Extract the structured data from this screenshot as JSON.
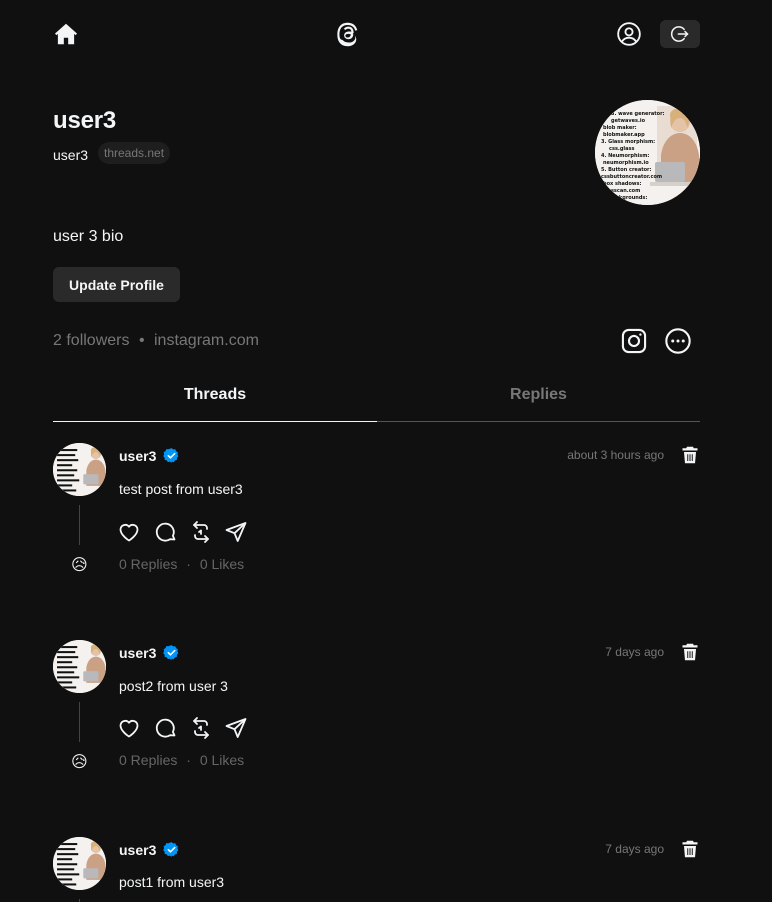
{
  "header": {
    "home_icon": "home-icon",
    "logo_icon": "threads-logo-icon",
    "profile_icon": "user-circle-icon",
    "logout_icon": "logout-icon"
  },
  "profile": {
    "name": "user3",
    "handle": "user3",
    "domain": "threads.net",
    "bio": "user 3 bio",
    "update_button": "Update Profile",
    "followers": "2 followers",
    "separator": "•",
    "link": "instagram.com",
    "avatar_caption_lines": [
      "wave generator:",
      "...",
      "blob maker:",
      "blobmaker.app",
      "3. Glass morphism:",
      "css.glass",
      "4. Neumorphism:",
      "neumorphism.io",
      "5. Button creator:",
      "cssbuttoncreator.com",
      "box shadows:",
      "...",
      "backgrounds:"
    ]
  },
  "tabs": [
    {
      "label": "Threads",
      "active": true
    },
    {
      "label": "Replies",
      "active": false
    }
  ],
  "posts": [
    {
      "user": "user3",
      "time": "about 3 hours ago",
      "text": "test post from user3",
      "replies": "0 Replies",
      "dot": "·",
      "likes": "0 Likes",
      "reply_emoji": "😥"
    },
    {
      "user": "user3",
      "time": "7 days ago",
      "text": "post2 from user 3",
      "replies": "0 Replies",
      "dot": "·",
      "likes": "0 Likes",
      "reply_emoji": "😥"
    },
    {
      "user": "user3",
      "time": "7 days ago",
      "text": "post1 from user3",
      "replies": "",
      "dot": "",
      "likes": "",
      "reply_emoji": ""
    }
  ],
  "colors": {
    "background": "#101010",
    "text": "#f3f5f7",
    "muted": "#777777",
    "verified": "#0095f6"
  }
}
